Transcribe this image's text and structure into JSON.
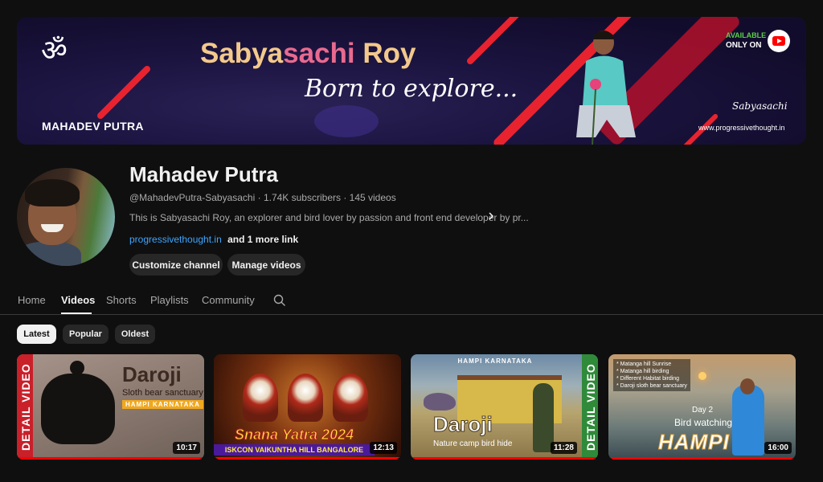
{
  "banner": {
    "name_part1": "Sabya",
    "name_part2": "sachi",
    "name_part3": " Roy",
    "tagline": "Born to explore...",
    "channel_label": "MAHADEV PUTRA",
    "available": "AVAILABLE",
    "only_on": "ONLY ON",
    "signature": "Sabyasachi",
    "url": "www.progressivethought.in",
    "om_symbol": "ॐ"
  },
  "channel": {
    "title": "Mahadev Putra",
    "handle": "@MahadevPutra-Sabyasachi",
    "subscribers": "1.74K subscribers",
    "videos_count": "145 videos",
    "meta_separator": " · ",
    "description": "This is Sabyasachi Roy, an explorer and bird lover by passion and front end developer by pr...",
    "link": "progressivethought.in",
    "more_links": "and 1 more link",
    "customize_label": "Customize channel",
    "manage_label": "Manage videos"
  },
  "tabs": [
    {
      "label": "Home"
    },
    {
      "label": "Videos",
      "active": true
    },
    {
      "label": "Shorts"
    },
    {
      "label": "Playlists"
    },
    {
      "label": "Community"
    }
  ],
  "chips": [
    {
      "label": "Latest",
      "selected": true
    },
    {
      "label": "Popular"
    },
    {
      "label": "Oldest"
    }
  ],
  "videos": [
    {
      "side_label": "DETAIL VIDEO",
      "title": "Daroji",
      "subtitle": "Sloth bear sanctuary",
      "location": "HAMPI KARNATAKA",
      "duration": "10:17"
    },
    {
      "title": "Snana Yatra 2024",
      "location": "ISKCON VAIKUNTHA HILL BANGALORE",
      "duration": "12:13"
    },
    {
      "top_label": "HAMPI KARNATAKA",
      "title": "Daroji",
      "subtitle": "Nature camp bird hide",
      "side_label": "DETAIL VIDEO",
      "duration": "11:28"
    },
    {
      "notes": [
        "* Matanga hill Sunrise",
        "* Matanga hill birding",
        "* Different Habitat birding",
        "* Daroji sloth bear sanctuary"
      ],
      "day": "Day 2",
      "subtitle": "Bird watching",
      "title": "HAMPI",
      "duration": "16:00"
    }
  ],
  "colors": {
    "background": "#0f0f0f",
    "link": "#3ea6ff",
    "button_bg": "#272727",
    "progress": "#ff0000"
  },
  "icons": {
    "search": "search-icon",
    "chevron": "chevron-right-icon",
    "youtube": "youtube-logo-icon"
  }
}
